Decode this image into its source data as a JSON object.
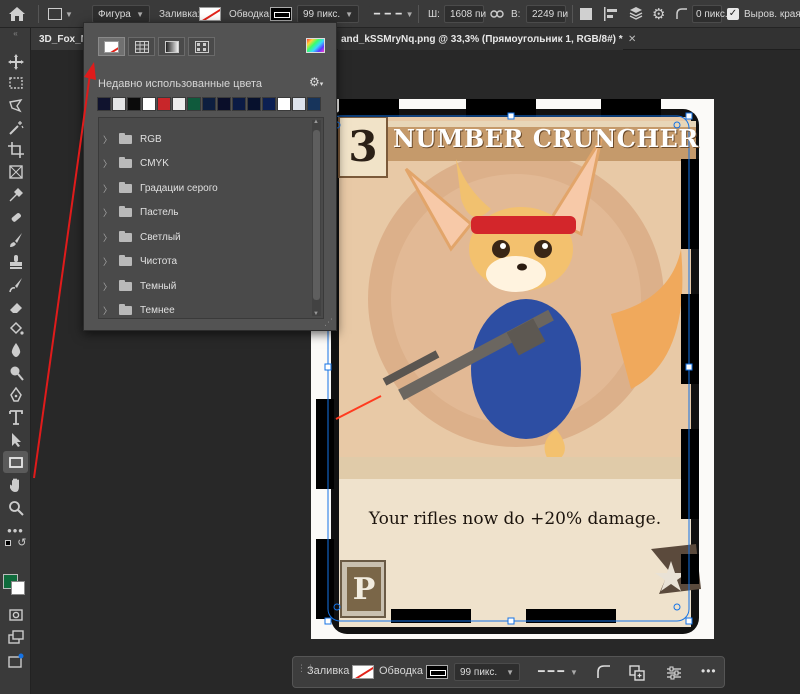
{
  "options_bar": {
    "shape_mode": "Фигура",
    "fill_label": "Заливка:",
    "stroke_label": "Обводка:",
    "stroke_size": "99 пикс.",
    "width_label": "Ш:",
    "width_value": "1608 пи",
    "height_label": "В:",
    "height_value": "2249 пи",
    "radius_value": "0 пикс.",
    "align_edges_label": "Выров. края"
  },
  "tabs": [
    {
      "label": "3D_Fox_N"
    },
    {
      "label": "and_kSSMryNq.png @ 33,3% (Прямоугольник 1, RGB/8#) *"
    }
  ],
  "popover": {
    "recent_label": "Недавно использованные цвета",
    "recent_colors": [
      "#10132e",
      "#e4e5e6",
      "#0b0b0b",
      "#ffffff",
      "#c8262a",
      "#ededed",
      "#0f5a3c",
      "#0d1e3f",
      "#0a0e29",
      "#0a1a44",
      "#07112d",
      "#0c1f52",
      "#ffffff",
      "#dde3ec",
      "#17345b"
    ],
    "folders": [
      "RGB",
      "CMYK",
      "Градации серого",
      "Пастель",
      "Светлый",
      "Чистота",
      "Темный",
      "Темнее"
    ]
  },
  "card": {
    "number": "3",
    "title": "NUMBER CRUNCHER",
    "text": "Your rifles now do +20% damage.",
    "badge": "P"
  },
  "context_bar": {
    "fill_label": "Заливка",
    "stroke_label": "Обводка",
    "stroke_size": "99 пикс."
  },
  "colors": {
    "accent": "#1473e6",
    "foreground": "#0f6b3c",
    "background": "#ffffff"
  }
}
